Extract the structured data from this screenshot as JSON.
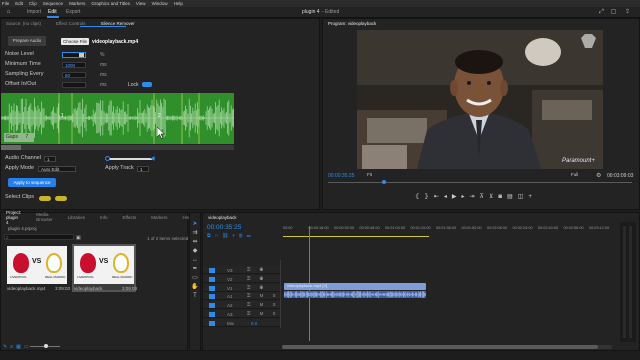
{
  "menu": [
    "File",
    "Edit",
    "Clip",
    "Sequence",
    "Markers",
    "Graphics and Titles",
    "View",
    "Window",
    "Help"
  ],
  "workspace": {
    "tabs": [
      "Import",
      "Edit",
      "Export"
    ],
    "active": "Edit",
    "title": "plugin 4",
    "subtitle": "- Edited"
  },
  "left_panel": {
    "tabs": [
      "Source: (no clips)",
      "Effect Controls",
      "Silence Remover"
    ],
    "prepare_audio": "Prepare Audio",
    "choose_file": "Choose File",
    "file_name": "videoplayback.mp4",
    "noise_level": {
      "label": "Noise Level",
      "value": "",
      "unit": "%"
    },
    "minimum_time": {
      "label": "Minimum Time",
      "value": "1000",
      "unit": "ms"
    },
    "sampling_every": {
      "label": "Sampling Every",
      "value": "50",
      "unit": "ms"
    },
    "offset": {
      "label": "Offset In/Out",
      "value": "",
      "unit": "ms"
    },
    "lock_label": "Lock",
    "marker_1": "1",
    "marker_2": "2",
    "gaps_label": "Gaps",
    "gaps_value": "7",
    "audio_channel": {
      "label": "Audio Channel",
      "value": "1"
    },
    "apply_mode": {
      "label": "Apply Mode",
      "value": "Auto Edit"
    },
    "apply_track": {
      "label": "Apply Track",
      "value": "1"
    },
    "apply_button": "Apply to sequence",
    "select_clips": "Select Clips"
  },
  "program": {
    "title": "Program: videoplayback",
    "timecode": "00:00:35:25",
    "fit": "Fit",
    "quality": "Full",
    "duration": "00:03:09:03",
    "watermark": "Paramount+"
  },
  "project": {
    "tabs": [
      "Project: plugin 4",
      "Media Browser",
      "Libraries",
      "Info",
      "Effects",
      "Markers",
      "History"
    ],
    "file": "plugin 4.prproj",
    "items_count": "1 of 2 items selected",
    "items": [
      {
        "name": "videoplayback.mp4",
        "duration": "3:09:03",
        "team_a": "LIVERPOOL",
        "team_b": "REAL MADRID"
      },
      {
        "name": "videoplayback",
        "duration": "3:09:03",
        "team_a": "LIVERPOOL",
        "team_b": "REAL MADRID"
      }
    ],
    "vs": "VS"
  },
  "timeline": {
    "tab": "videoplayback",
    "timecode": "00:00:35:25",
    "ruler": [
      "00:00",
      "00:00:16:00",
      "00:00:32:00",
      "00:00:48:00",
      "00:01:04:00",
      "00:01:20:00",
      "00:01:36:00",
      "00:01:52:00",
      "00:02:08:00",
      "00:02:24:00",
      "00:02:40:00",
      "00:02:56:00",
      "00:03:12:00"
    ],
    "tracks": [
      "V3",
      "V2",
      "V1",
      "A1",
      "A2",
      "A3",
      "Mix"
    ],
    "mix_value": "0.0",
    "video_clip": "videoplayback.mp4 [V]"
  },
  "colors": {
    "accent": "#2d8ceb",
    "wave": "#2f8f2a",
    "video_clip": "#7e9cd6",
    "audio_clip": "#3d60a8"
  }
}
